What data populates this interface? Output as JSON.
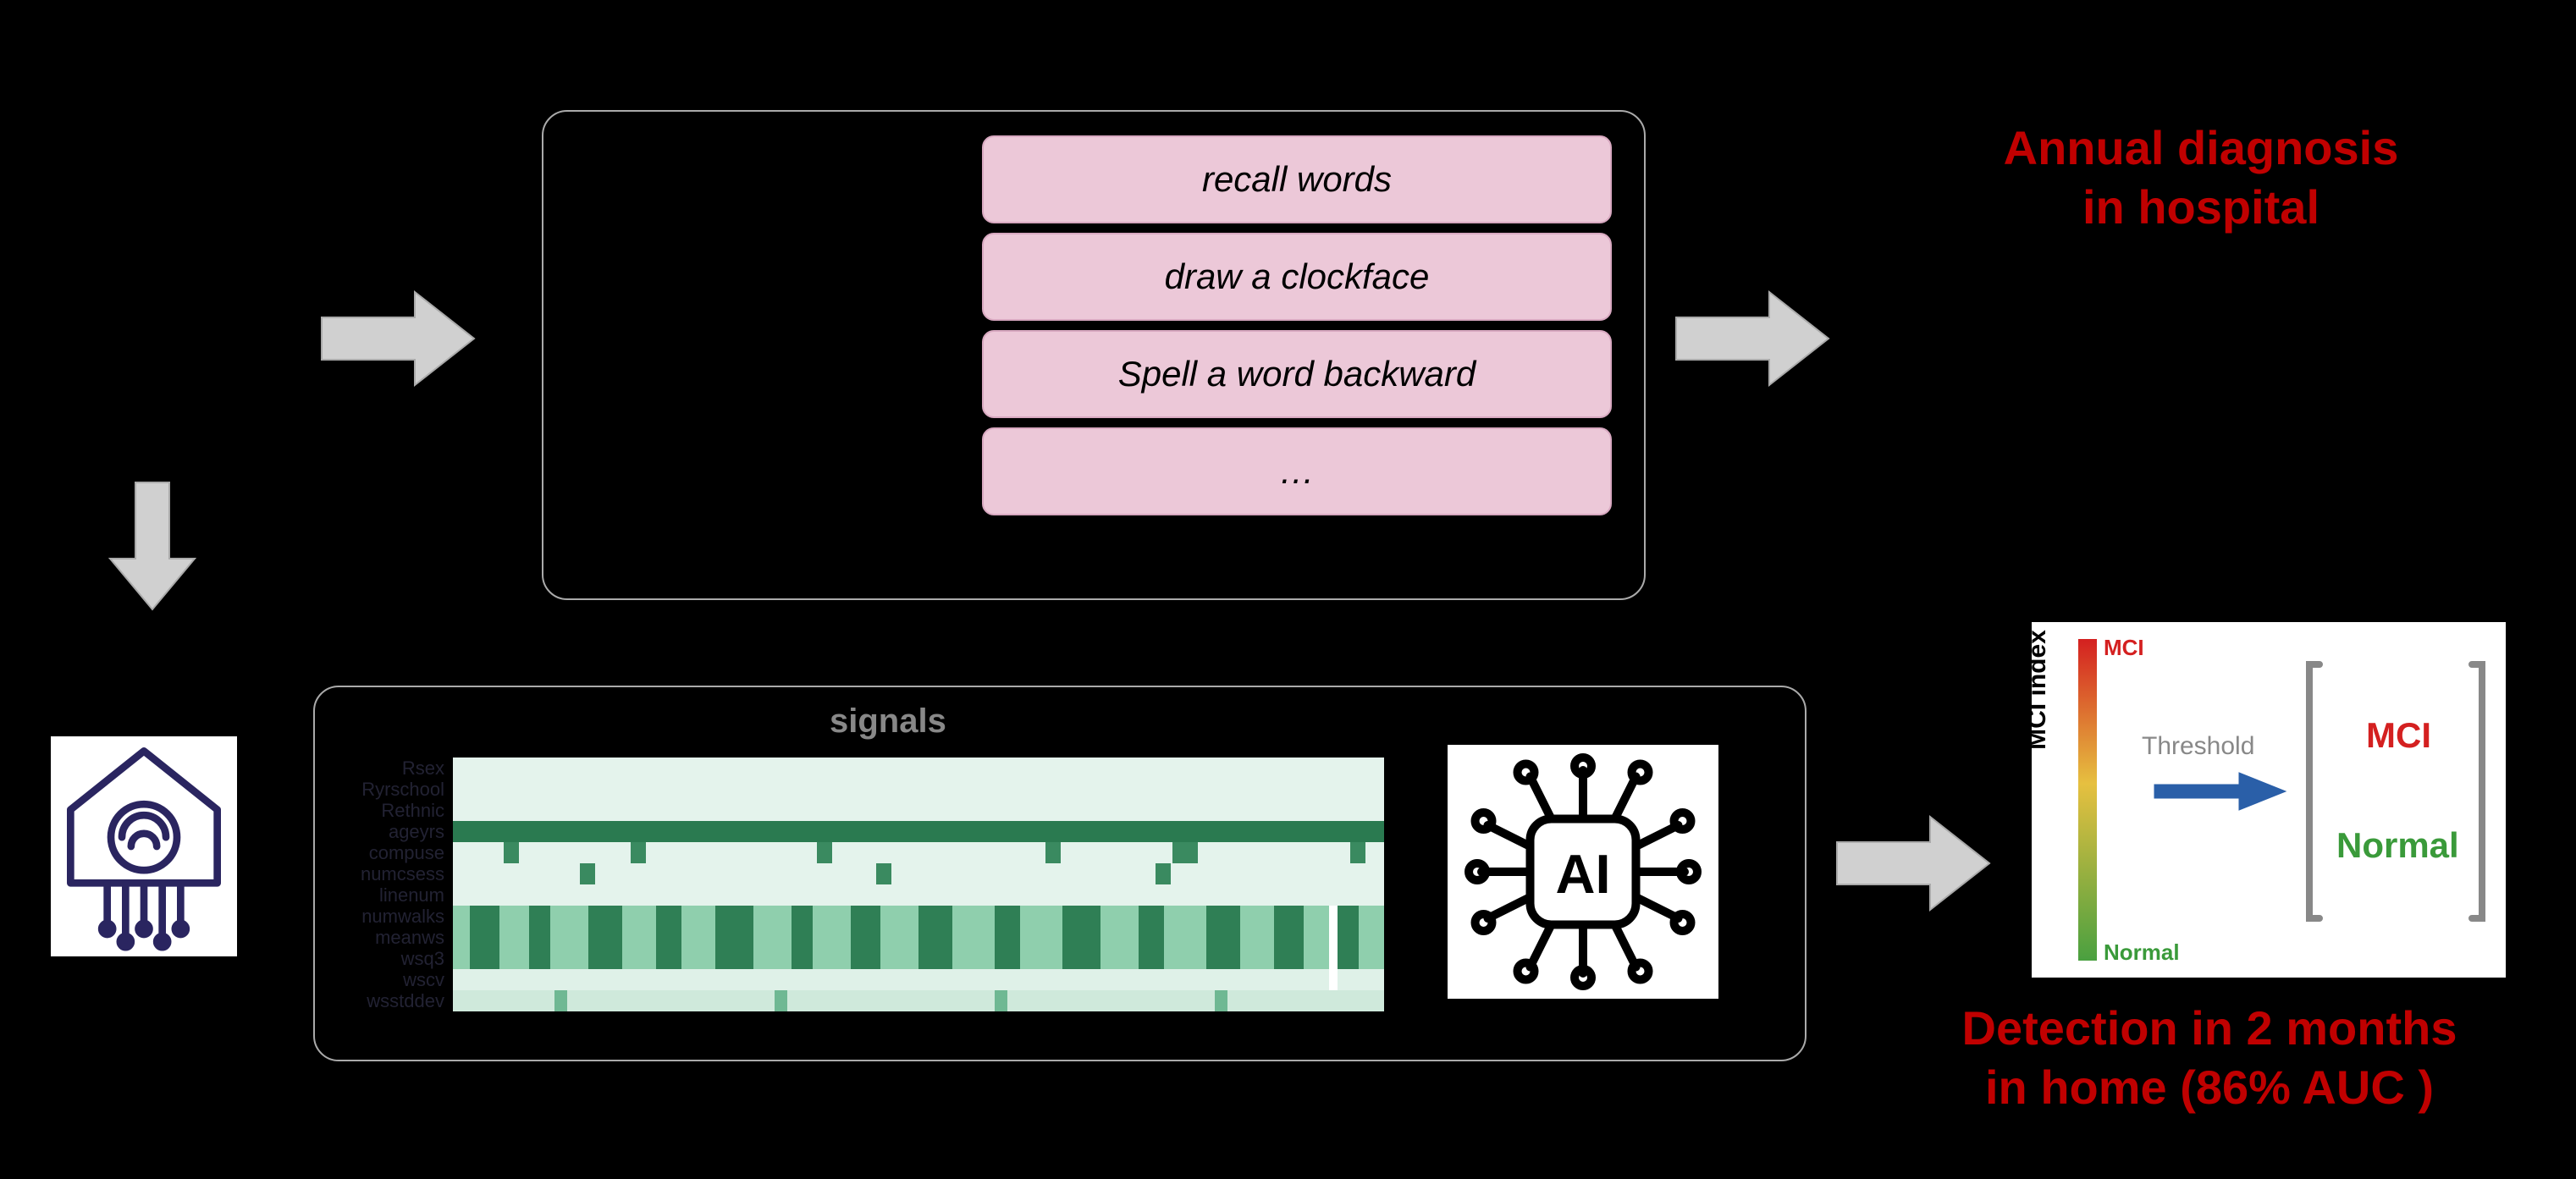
{
  "top": {
    "pills": [
      "recall words",
      "draw a clockface",
      "Spell a word backward",
      "…"
    ],
    "caption": "Annual diagnosis\nin hospital"
  },
  "bottom": {
    "signals_label": "signals",
    "heatmap_rows": [
      "Rsex",
      "Ryrschool",
      "Rethnic",
      "ageyrs",
      "compuse",
      "numcsess",
      "linenum",
      "numwalks",
      "meanws",
      "wsq3",
      "wscv",
      "wsstddev"
    ],
    "caption": "Detection in 2 months\nin home (86% AUC )"
  },
  "mci_panel": {
    "ylabel": "MCI index",
    "top": "MCI",
    "bottom": "Normal",
    "threshold": "Threshold",
    "out_top": "MCI",
    "out_bottom": "Normal"
  },
  "chart_data": {
    "type": "heatmap",
    "title": "signals",
    "rows": [
      "Rsex",
      "Ryrschool",
      "Rethnic",
      "ageyrs",
      "compuse",
      "numcsess",
      "linenum",
      "numwalks",
      "meanws",
      "wsq3",
      "wscv",
      "wsstddev"
    ],
    "cols_count": 60,
    "note": "cell intensities are qualitative shades of green; exact values not labeled in image",
    "colormap": "light-green to dark-green"
  }
}
